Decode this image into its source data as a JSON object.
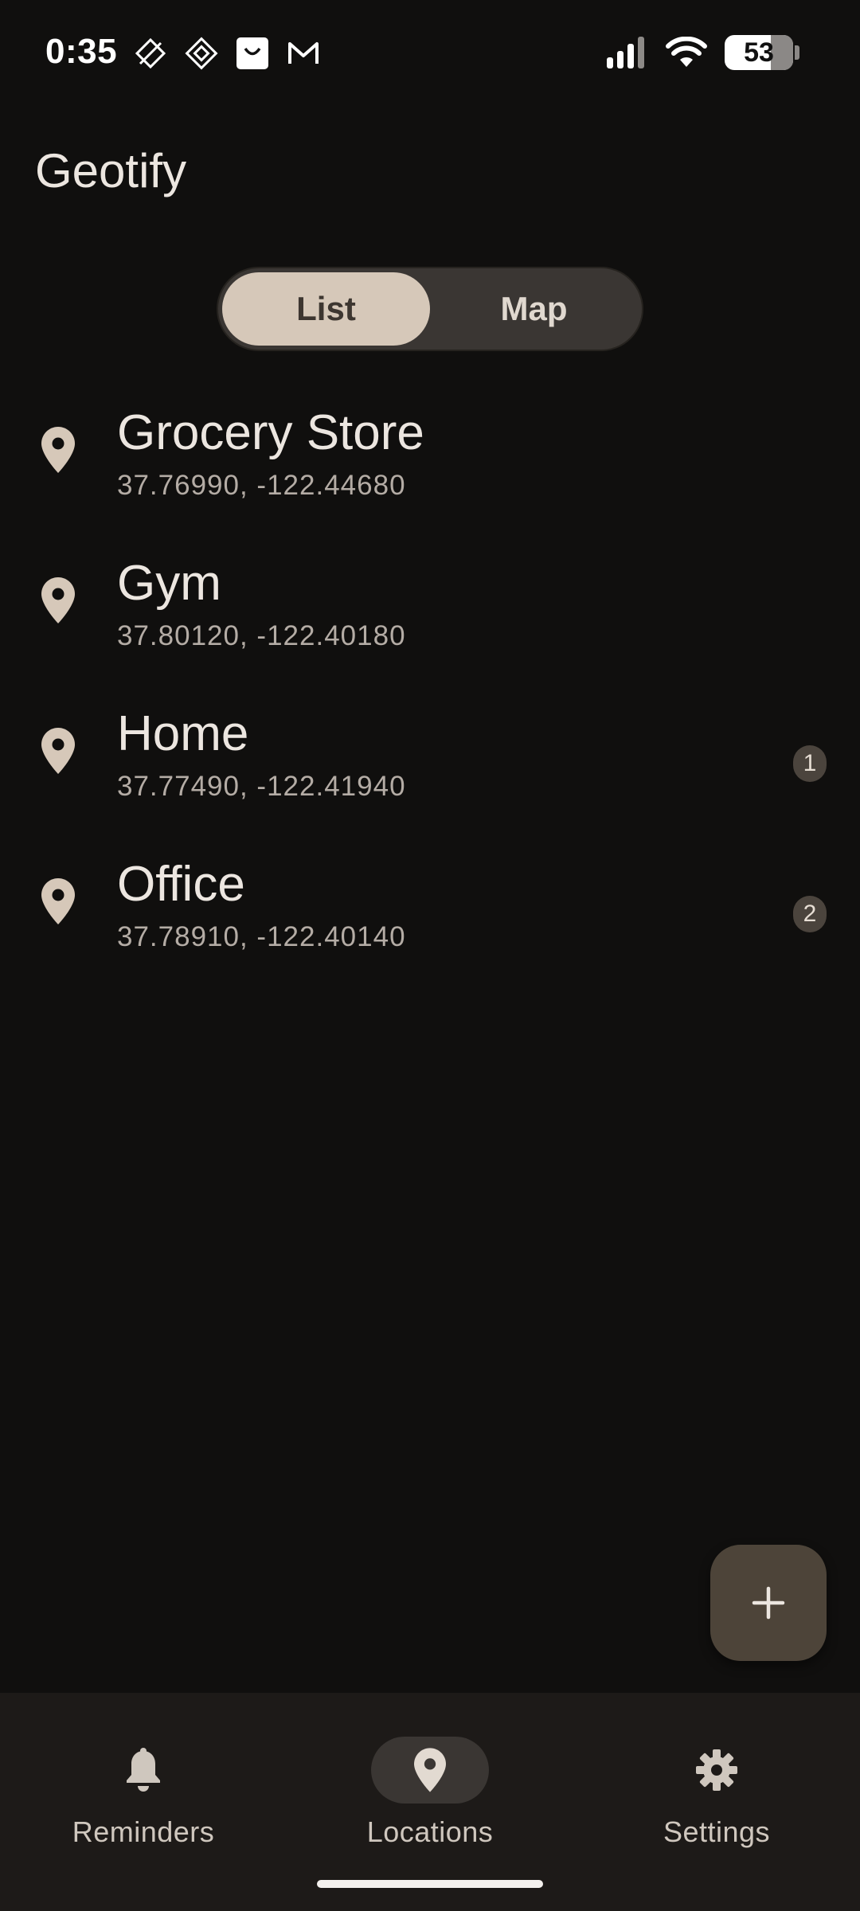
{
  "status_bar": {
    "time": "0:35",
    "battery": "53",
    "left_icons": [
      "notification-icon-1",
      "notification-icon-2",
      "shopping-icon",
      "gmail-icon"
    ],
    "right_icons": [
      "signal-icon",
      "wifi-icon",
      "battery-icon"
    ]
  },
  "header": {
    "title": "Geotify"
  },
  "view_toggle": {
    "list_label": "List",
    "map_label": "Map",
    "selected": "List"
  },
  "locations": [
    {
      "name": "Grocery Store",
      "coords": "37.76990, -122.44680",
      "count": ""
    },
    {
      "name": "Gym",
      "coords": "37.80120, -122.40180",
      "count": ""
    },
    {
      "name": "Home",
      "coords": "37.77490, -122.41940",
      "count": "1"
    },
    {
      "name": "Office",
      "coords": "37.78910, -122.40140",
      "count": "2"
    }
  ],
  "fab": {
    "icon": "plus-icon"
  },
  "bottom_nav": {
    "items": [
      {
        "label": "Reminders",
        "icon": "bell-icon"
      },
      {
        "label": "Locations",
        "icon": "location-pin-icon"
      },
      {
        "label": "Settings",
        "icon": "gear-icon"
      }
    ],
    "selected": "Locations"
  },
  "colors": {
    "background": "#100f0e",
    "accent": "#d6c8b9",
    "fab": "#4d4439",
    "nav_bg": "#1d1a18"
  }
}
